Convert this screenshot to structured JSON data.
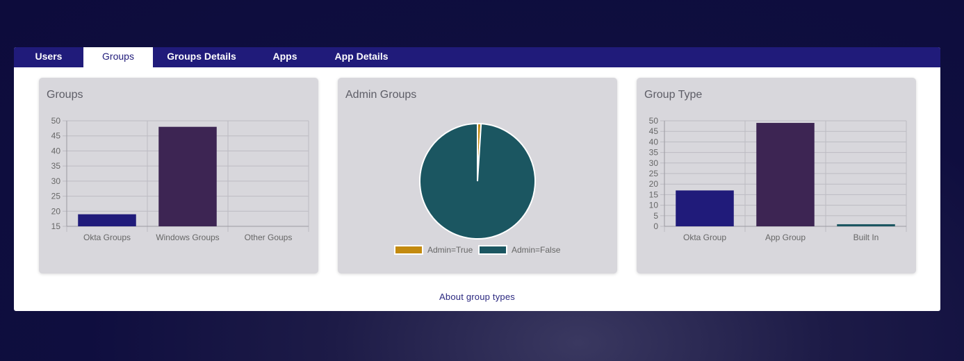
{
  "tabs": [
    {
      "label": "Users"
    },
    {
      "label": "Groups"
    },
    {
      "label": "Groups Details"
    },
    {
      "label": "Apps"
    },
    {
      "label": "App Details"
    }
  ],
  "active_tab": "Groups",
  "footer": {
    "link_label": "About group types"
  },
  "colors": {
    "navy": "#201b7a",
    "purple": "#3d2553",
    "teal": "#1b5661",
    "gold": "#c38a0f",
    "card_bg": "#d8d7dc"
  },
  "cards": [
    {
      "title": "Groups"
    },
    {
      "title": "Admin Groups"
    },
    {
      "title": "Group Type"
    }
  ],
  "chart_data": [
    {
      "type": "bar",
      "title": "Groups",
      "categories": [
        "Okta Groups",
        "Windows Groups",
        "Other Goups"
      ],
      "values": [
        19,
        48,
        0
      ],
      "colors": [
        "#201b7a",
        "#3d2553",
        "#1b5661"
      ],
      "ylim": [
        15,
        50
      ],
      "yticks": [
        15,
        20,
        25,
        30,
        35,
        40,
        45,
        50
      ],
      "grid": true
    },
    {
      "type": "pie",
      "title": "Admin Groups",
      "labels": [
        "Admin=True",
        "Admin=False"
      ],
      "values": [
        1,
        99
      ],
      "colors": [
        "#c38a0f",
        "#1b5661"
      ],
      "legend": "bottom"
    },
    {
      "type": "bar",
      "title": "Group Type",
      "categories": [
        "Okta Group",
        "App Group",
        "Built In"
      ],
      "values": [
        17,
        49,
        1
      ],
      "colors": [
        "#201b7a",
        "#3d2553",
        "#1b5661"
      ],
      "ylim": [
        0,
        50
      ],
      "yticks": [
        0,
        5,
        10,
        15,
        20,
        25,
        30,
        35,
        40,
        45,
        50
      ],
      "grid": true
    }
  ]
}
